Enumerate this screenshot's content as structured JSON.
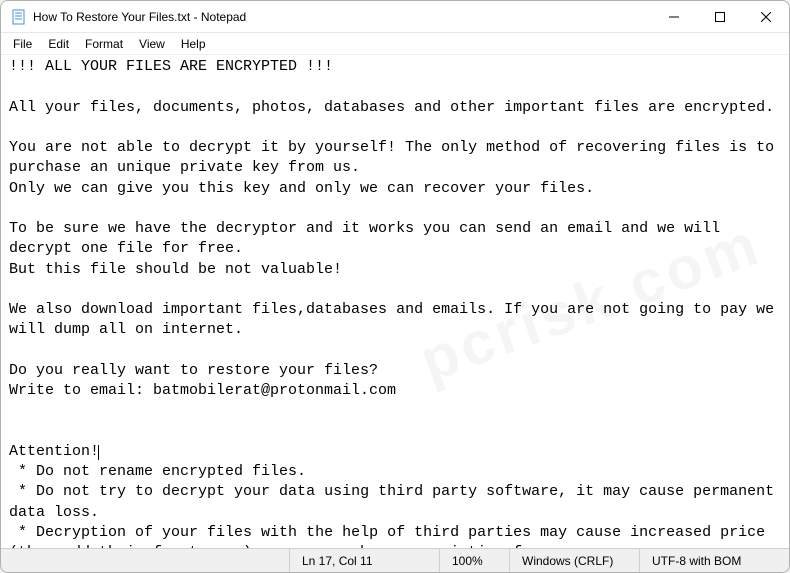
{
  "window": {
    "title": "How To Restore Your Files.txt - Notepad"
  },
  "menu": {
    "file": "File",
    "edit": "Edit",
    "format": "Format",
    "view": "View",
    "help": "Help"
  },
  "content": {
    "line1": "!!! ALL YOUR FILES ARE ENCRYPTED !!!",
    "line2": "",
    "line3": "All your files, documents, photos, databases and other important files are encrypted.",
    "line4": "",
    "line5": "You are not able to decrypt it by yourself! The only method of recovering files is to purchase an unique private key from us.",
    "line6": "Only we can give you this key and only we can recover your files.",
    "line7": "",
    "line8": "To be sure we have the decryptor and it works you can send an email and we will decrypt one file for free.",
    "line9": "But this file should be not valuable!",
    "line10": "",
    "line11": "We also download important files,databases and emails. If you are not going to pay we will dump all on internet.",
    "line12": "",
    "line13": "Do you really want to restore your files?",
    "line14": "Write to email: batmobilerat@protonmail.com",
    "line15": "",
    "line16": "",
    "line17a": "Attention!",
    "line18": " * Do not rename encrypted files.",
    "line19": " * Do not try to decrypt your data using third party software, it may cause permanent data loss.",
    "line20": " * Decryption of your files with the help of third parties may cause increased price (they add their fee to our) or you can become a victim of a scam."
  },
  "statusbar": {
    "lncol": "Ln 17, Col 11",
    "zoom": "100%",
    "eol": "Windows (CRLF)",
    "encoding": "UTF-8 with BOM"
  }
}
